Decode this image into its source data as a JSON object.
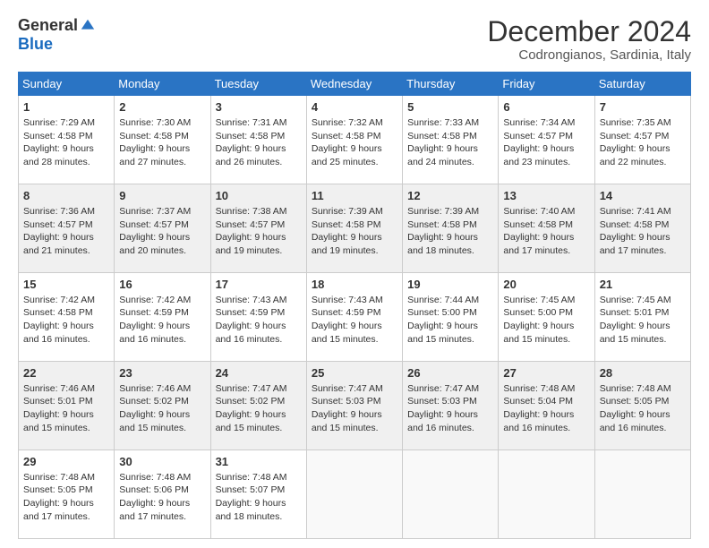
{
  "header": {
    "logo_general": "General",
    "logo_blue": "Blue",
    "month_title": "December 2024",
    "location": "Codrongianos, Sardinia, Italy"
  },
  "weekdays": [
    "Sunday",
    "Monday",
    "Tuesday",
    "Wednesday",
    "Thursday",
    "Friday",
    "Saturday"
  ],
  "weeks": [
    [
      {
        "day": "1",
        "sunrise": "7:29 AM",
        "sunset": "4:58 PM",
        "daylight": "9 hours and 28 minutes."
      },
      {
        "day": "2",
        "sunrise": "7:30 AM",
        "sunset": "4:58 PM",
        "daylight": "9 hours and 27 minutes."
      },
      {
        "day": "3",
        "sunrise": "7:31 AM",
        "sunset": "4:58 PM",
        "daylight": "9 hours and 26 minutes."
      },
      {
        "day": "4",
        "sunrise": "7:32 AM",
        "sunset": "4:58 PM",
        "daylight": "9 hours and 25 minutes."
      },
      {
        "day": "5",
        "sunrise": "7:33 AM",
        "sunset": "4:58 PM",
        "daylight": "9 hours and 24 minutes."
      },
      {
        "day": "6",
        "sunrise": "7:34 AM",
        "sunset": "4:57 PM",
        "daylight": "9 hours and 23 minutes."
      },
      {
        "day": "7",
        "sunrise": "7:35 AM",
        "sunset": "4:57 PM",
        "daylight": "9 hours and 22 minutes."
      }
    ],
    [
      {
        "day": "8",
        "sunrise": "7:36 AM",
        "sunset": "4:57 PM",
        "daylight": "9 hours and 21 minutes."
      },
      {
        "day": "9",
        "sunrise": "7:37 AM",
        "sunset": "4:57 PM",
        "daylight": "9 hours and 20 minutes."
      },
      {
        "day": "10",
        "sunrise": "7:38 AM",
        "sunset": "4:57 PM",
        "daylight": "9 hours and 19 minutes."
      },
      {
        "day": "11",
        "sunrise": "7:39 AM",
        "sunset": "4:58 PM",
        "daylight": "9 hours and 19 minutes."
      },
      {
        "day": "12",
        "sunrise": "7:39 AM",
        "sunset": "4:58 PM",
        "daylight": "9 hours and 18 minutes."
      },
      {
        "day": "13",
        "sunrise": "7:40 AM",
        "sunset": "4:58 PM",
        "daylight": "9 hours and 17 minutes."
      },
      {
        "day": "14",
        "sunrise": "7:41 AM",
        "sunset": "4:58 PM",
        "daylight": "9 hours and 17 minutes."
      }
    ],
    [
      {
        "day": "15",
        "sunrise": "7:42 AM",
        "sunset": "4:58 PM",
        "daylight": "9 hours and 16 minutes."
      },
      {
        "day": "16",
        "sunrise": "7:42 AM",
        "sunset": "4:59 PM",
        "daylight": "9 hours and 16 minutes."
      },
      {
        "day": "17",
        "sunrise": "7:43 AM",
        "sunset": "4:59 PM",
        "daylight": "9 hours and 16 minutes."
      },
      {
        "day": "18",
        "sunrise": "7:43 AM",
        "sunset": "4:59 PM",
        "daylight": "9 hours and 15 minutes."
      },
      {
        "day": "19",
        "sunrise": "7:44 AM",
        "sunset": "5:00 PM",
        "daylight": "9 hours and 15 minutes."
      },
      {
        "day": "20",
        "sunrise": "7:45 AM",
        "sunset": "5:00 PM",
        "daylight": "9 hours and 15 minutes."
      },
      {
        "day": "21",
        "sunrise": "7:45 AM",
        "sunset": "5:01 PM",
        "daylight": "9 hours and 15 minutes."
      }
    ],
    [
      {
        "day": "22",
        "sunrise": "7:46 AM",
        "sunset": "5:01 PM",
        "daylight": "9 hours and 15 minutes."
      },
      {
        "day": "23",
        "sunrise": "7:46 AM",
        "sunset": "5:02 PM",
        "daylight": "9 hours and 15 minutes."
      },
      {
        "day": "24",
        "sunrise": "7:47 AM",
        "sunset": "5:02 PM",
        "daylight": "9 hours and 15 minutes."
      },
      {
        "day": "25",
        "sunrise": "7:47 AM",
        "sunset": "5:03 PM",
        "daylight": "9 hours and 15 minutes."
      },
      {
        "day": "26",
        "sunrise": "7:47 AM",
        "sunset": "5:03 PM",
        "daylight": "9 hours and 16 minutes."
      },
      {
        "day": "27",
        "sunrise": "7:48 AM",
        "sunset": "5:04 PM",
        "daylight": "9 hours and 16 minutes."
      },
      {
        "day": "28",
        "sunrise": "7:48 AM",
        "sunset": "5:05 PM",
        "daylight": "9 hours and 16 minutes."
      }
    ],
    [
      {
        "day": "29",
        "sunrise": "7:48 AM",
        "sunset": "5:05 PM",
        "daylight": "9 hours and 17 minutes."
      },
      {
        "day": "30",
        "sunrise": "7:48 AM",
        "sunset": "5:06 PM",
        "daylight": "9 hours and 17 minutes."
      },
      {
        "day": "31",
        "sunrise": "7:48 AM",
        "sunset": "5:07 PM",
        "daylight": "9 hours and 18 minutes."
      },
      null,
      null,
      null,
      null
    ]
  ],
  "labels": {
    "sunrise": "Sunrise:",
    "sunset": "Sunset:",
    "daylight": "Daylight:"
  }
}
